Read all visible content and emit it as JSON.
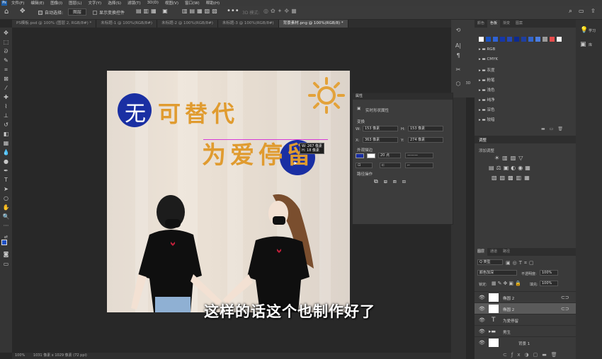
{
  "menubar": {
    "logo": "Ps",
    "items": [
      "文件(F)",
      "编辑(E)",
      "图像(I)",
      "图层(L)",
      "文字(Y)",
      "选择(S)",
      "滤镜(T)",
      "3D(D)",
      "视图(V)",
      "窗口(W)",
      "帮助(H)"
    ]
  },
  "options": {
    "auto_select_label": "自动选择:",
    "auto_select_value": "图层",
    "transform_label": "显示变换控件",
    "mode_3d": "3D 模式:"
  },
  "tabs": [
    "PS模板.psd @ 100% (图层 2, RGB/8#) *",
    "未标题-1 @ 100%(RGB/8#)",
    "未标题-2 @ 100%(RGB/8#)",
    "未标题-3 @ 100%(RGB/8#)",
    "背景素材.png @ 100%(RGB/8) *"
  ],
  "canvas": {
    "title_line1": "可替代",
    "title_line2": "为爱停留",
    "badge_char": "无",
    "tooltip_w": "W: 267 像素",
    "tooltip_h": "H: 18 像素"
  },
  "status": {
    "zoom": "100%",
    "doc": "1031 像素 x 1029 像素 (72 ppi)"
  },
  "properties": {
    "title": "属性",
    "shape_type": "实时形状属性",
    "section_transform": "变换",
    "w_label": "W:",
    "w_value": "153 像素",
    "h_label": "H:",
    "h_value": "153 像素",
    "x_label": "X:",
    "x_value": "363 像素",
    "y_label": "Y:",
    "y_value": "274 像素",
    "section_appearance": "外观描边",
    "stroke_size": "20 点",
    "section_path_ops": "路径操作"
  },
  "swatches_panel": {
    "tabs": [
      "颜色",
      "色板",
      "渐变",
      "图案"
    ],
    "active_tab": "色板",
    "colors": [
      "#ffffff",
      "#1a52c4",
      "#2f63d6",
      "#1637a8",
      "#2448b8",
      "#0d2a8f",
      "#1f3fa0",
      "#3366cc",
      "#4a7de0",
      "#9a9a9a",
      "#e84c4c",
      "#f2f2f2"
    ],
    "folders": [
      "RGB",
      "CMYK",
      "灰度",
      "粉笔",
      "浅色",
      "纯净",
      "深色",
      "较暗"
    ]
  },
  "adjustments_panel": {
    "title": "调整",
    "add_label": "添加调整"
  },
  "layers_panel": {
    "tabs": [
      "图层",
      "通道",
      "路径"
    ],
    "kind_filter": "Q 类型",
    "blend_mode": "颜色加深",
    "opacity_label": "不透明度:",
    "opacity_value": "100%",
    "lock_label": "锁定:",
    "fill_label": "填充:",
    "fill_value": "100%",
    "layers": [
      {
        "name": "椭圆 2",
        "selected": false
      },
      {
        "name": "椭圆 2",
        "selected": true
      },
      {
        "name": "为爱停留",
        "selected": false
      },
      {
        "name": "男生",
        "selected": false
      },
      {
        "name": "背景 1",
        "selected": false
      }
    ]
  },
  "right_edge": {
    "learn": "学习",
    "libraries": "库"
  },
  "subtitle": "这样的话这个也制作好了"
}
